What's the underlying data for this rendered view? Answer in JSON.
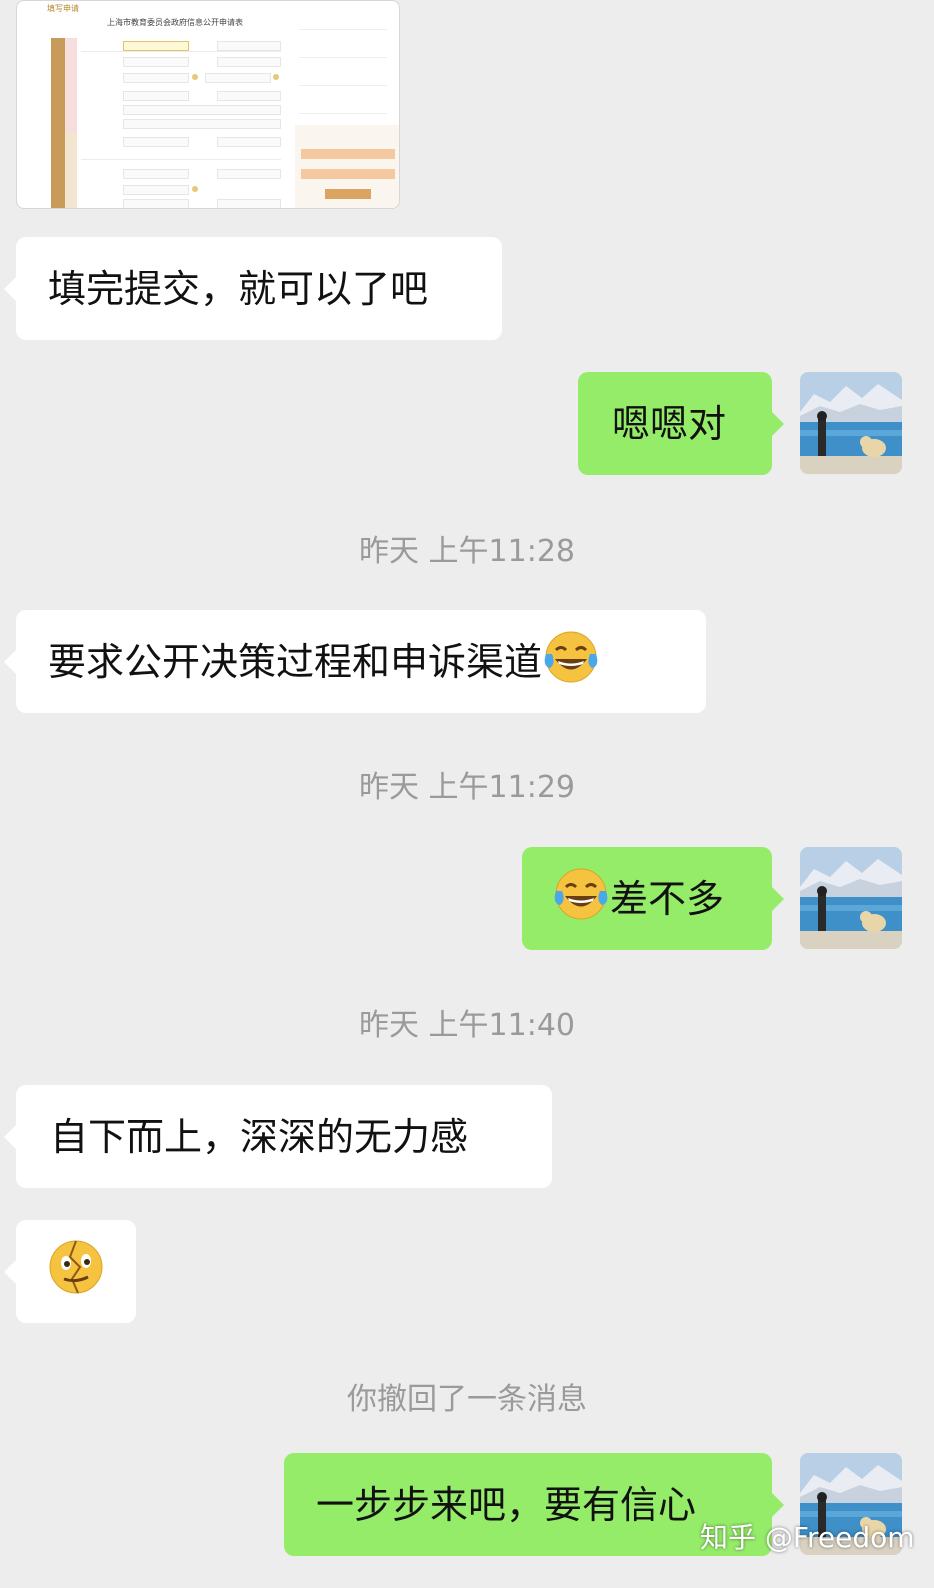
{
  "colors": {
    "background": "#ededed",
    "incoming_bubble": "#ffffff",
    "outgoing_bubble": "#95ec69",
    "timestamp_text": "#9a9a9a"
  },
  "attachment": {
    "header": "填写申请",
    "form_title": "上海市教育委员会政府信息公开申请表"
  },
  "messages": [
    {
      "side": "left",
      "text": "填完提交，就可以了吧"
    },
    {
      "side": "right",
      "text": "嗯嗯对"
    },
    {
      "side": "left",
      "text": "要求公开决策过程和申诉渠道",
      "emoji": "tears-of-joy-emoji"
    },
    {
      "side": "right",
      "text": "差不多",
      "emoji": "tears-of-joy-emoji"
    },
    {
      "side": "left",
      "text": "自下而上，深深的无力感"
    },
    {
      "side": "left",
      "emoji": "broken-face-emoji"
    },
    {
      "side": "right",
      "text": "一步步来吧，要有信心"
    }
  ],
  "timestamps": [
    "昨天 上午11:28",
    "昨天 上午11:29",
    "昨天 上午11:40"
  ],
  "system_notice": "你撤回了一条消息",
  "watermark": "知乎 @Freedom",
  "icons": {
    "avatar": "landscape-photo-avatar",
    "tears_of_joy": "tears-of-joy-emoji",
    "broken_face": "broken-face-emoji"
  }
}
